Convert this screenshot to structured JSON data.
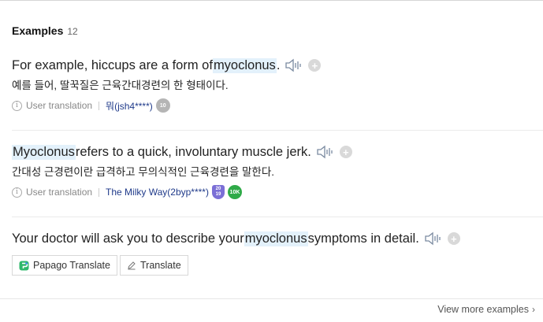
{
  "header": {
    "title": "Examples",
    "count": "12"
  },
  "examples": [
    {
      "before": "For example, hiccups are a form of ",
      "highlight": "myoclonus",
      "after": ".",
      "translation": "예를 들어, 딸꾹질은 근육간대경련의 한 형태이다.",
      "meta_label": "User translation",
      "user": "뭐(jsh4****)",
      "badges": [
        "10"
      ]
    },
    {
      "before": "",
      "highlight": "Myoclonus",
      "after": " refers to a quick, involuntary muscle jerk.",
      "translation": "간대성 근경련이란 급격하고 무의식적인 근육경련을 말한다.",
      "meta_label": "User translation",
      "user": "The Milky Way(2byp****)",
      "badges": [
        "20\n19",
        "10K"
      ]
    },
    {
      "before": "Your doctor will ask you to describe your ",
      "highlight": "myoclonus",
      "after": " symptoms in detail."
    }
  ],
  "actions": {
    "papago": "Papago Translate",
    "translate": "Translate"
  },
  "footer": {
    "more": "View more examples",
    "chevron": "›"
  },
  "icons": {
    "plus": "+",
    "info": "i"
  },
  "colors": {
    "highlight_bg": "#e3f1fb",
    "user_link": "#1f3a8a",
    "badge_green": "#2faa48",
    "badge_purple": "#7b6fd6"
  }
}
